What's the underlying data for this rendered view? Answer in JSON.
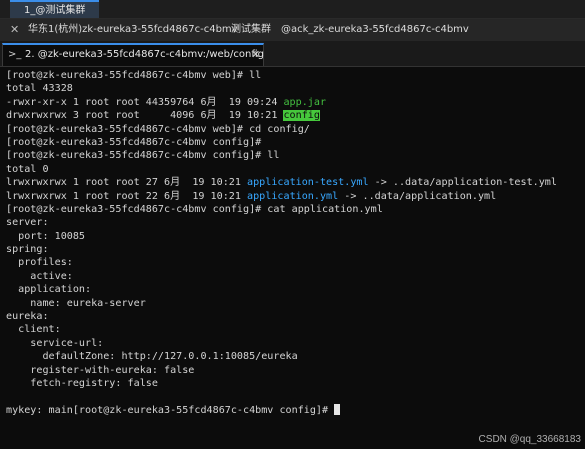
{
  "top_tab": {
    "label": "1_@测试集群"
  },
  "session": {
    "close_icon": "close-icon",
    "region": "华东1(杭州)zk-eureka3-55fcd4867c-c4bmv",
    "cluster": "测试集群",
    "pod": "@ack_zk-eureka3-55fcd4867c-c4bmv"
  },
  "terminal_tab": {
    "icon": "terminal-prompt-icon",
    "label": "2. @zk-eureka3-55fcd4867c-c4bmv:/web/config",
    "close_icon": "close-icon"
  },
  "colors": {
    "background": "#0c0c0c",
    "text": "#d4d4d4",
    "executable": "#44c040",
    "directory_highlight": "#46c83c",
    "symlink": "#38a8ff",
    "accent": "#3b8eea"
  },
  "terminal": {
    "lines": [
      "[root@zk-eureka3-55fcd4867c-c4bmv web]# ll",
      "total 43328",
      {
        "prefix": "-rwxr-xr-x 1 root root 44359764 6月  19 09:24 ",
        "name": "app.jar",
        "kind": "exec"
      },
      {
        "prefix": "drwxrwxrwx 3 root root     4096 6月  19 10:21 ",
        "name": "config",
        "kind": "dir"
      },
      "[root@zk-eureka3-55fcd4867c-c4bmv web]# cd config/",
      "[root@zk-eureka3-55fcd4867c-c4bmv config]#",
      "[root@zk-eureka3-55fcd4867c-c4bmv config]# ll",
      "total 0",
      {
        "prefix": "lrwxrwxrwx 1 root root 27 6月  19 10:21 ",
        "name": "application-test.yml",
        "suffix": " -> ..data/application-test.yml",
        "kind": "link"
      },
      {
        "prefix": "lrwxrwxrwx 1 root root 22 6月  19 10:21 ",
        "name": "application.yml",
        "suffix": " -> ..data/application.yml",
        "kind": "link"
      },
      "[root@zk-eureka3-55fcd4867c-c4bmv config]# cat application.yml",
      "server:",
      "  port: 10085",
      "spring:",
      "  profiles:",
      "    active:",
      "  application:",
      "    name: eureka-server",
      "eureka:",
      "  client:",
      "    service-url:",
      "      defaultZone: http://127.0.0.1:10085/eureka",
      "    register-with-eureka: false",
      "    fetch-registry: false",
      "",
      {
        "prompt": "mykey: main[root@zk-eureka3-55fcd4867c-c4bmv config]# ",
        "cursor": true
      }
    ]
  },
  "watermark": "CSDN @qq_33668183"
}
